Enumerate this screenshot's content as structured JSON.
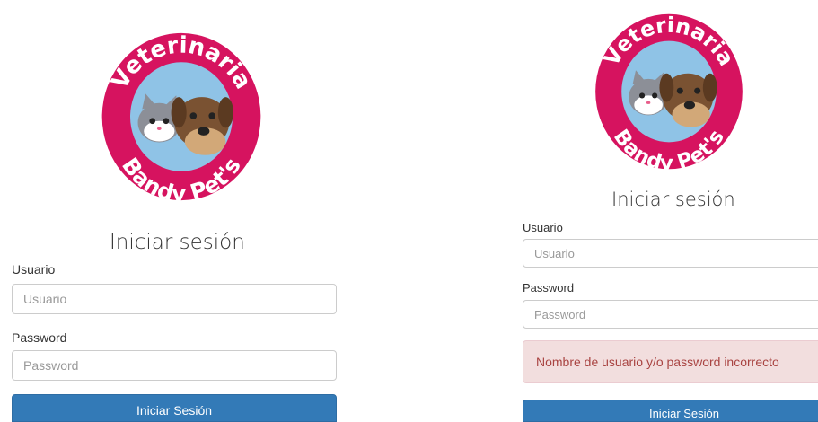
{
  "logo": {
    "top_text": "Veterinaria",
    "bottom_text": "Bandy Pet's",
    "colors": {
      "ring": "#d6135f",
      "sky": "#8fc3e6",
      "dog": "#7a5232",
      "cat": "#8c8f97"
    }
  },
  "left_form": {
    "title": "Iniciar sesión",
    "username_label": "Usuario",
    "username_placeholder": "Usuario",
    "password_label": "Password",
    "password_placeholder": "Password",
    "submit_label": "Iniciar Sesión"
  },
  "right_form": {
    "title": "Iniciar sesión",
    "username_label": "Usuario",
    "username_placeholder": "Usuario",
    "password_label": "Password",
    "password_placeholder": "Password",
    "error_message": "Nombre de usuario y/o password incorrecto",
    "submit_label": "Iniciar Sesión"
  },
  "colors": {
    "primary": "#337ab7",
    "error_bg": "#f2dede",
    "error_text": "#a94442"
  }
}
